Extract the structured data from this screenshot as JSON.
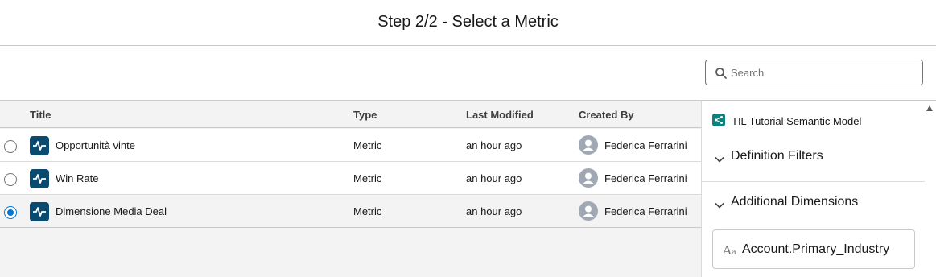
{
  "dialog": {
    "title": "Step 2/2 - Select a Metric"
  },
  "search": {
    "placeholder": "Search",
    "value": ""
  },
  "table": {
    "columns": [
      "Title",
      "Type",
      "Last Modified",
      "Created By"
    ],
    "rows": [
      {
        "title": "Opportunità vinte",
        "type": "Metric",
        "last_modified": "an hour ago",
        "created_by": "Federica Ferrarini",
        "selected": false
      },
      {
        "title": "Win Rate",
        "type": "Metric",
        "last_modified": "an hour ago",
        "created_by": "Federica Ferrarini",
        "selected": false
      },
      {
        "title": "Dimensione Media Deal",
        "type": "Metric",
        "last_modified": "an hour ago",
        "created_by": "Federica Ferrarini",
        "selected": true
      }
    ]
  },
  "details": {
    "model_name": "TIL Tutorial Semantic Model",
    "sections": [
      "Definition Filters",
      "Additional Dimensions"
    ],
    "dimensions": [
      "Account.Primary_Industry"
    ]
  },
  "icons": {
    "search": "search-icon",
    "metric": "pulse-icon",
    "avatar": "user-avatar-icon",
    "model": "semantic-model-icon",
    "chevron": "chevron-down-icon",
    "text_field": "text-field-icon",
    "scroll": "scroll-up-icon"
  },
  "colors": {
    "accent": "#0176d3",
    "metric_icon_bg": "#0b4a6f",
    "model_icon_bg": "#0b827c",
    "selected_row_bg": "#f3f3f3"
  }
}
